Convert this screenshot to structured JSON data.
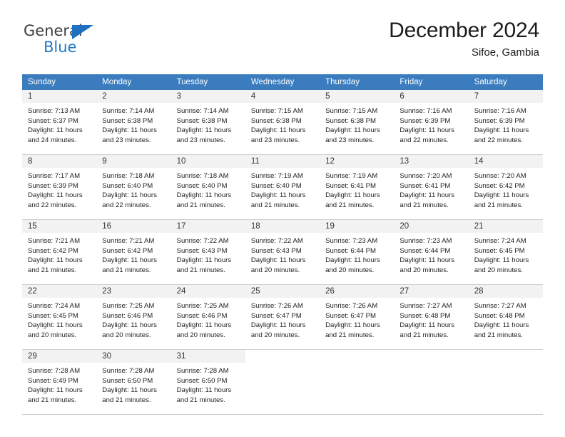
{
  "brand": {
    "name_top": "General",
    "name_bottom": "Blue",
    "triangle_color": "#1f70c1",
    "text_color": "#3d3d3d",
    "blue_color": "#2079c8"
  },
  "header": {
    "title": "December 2024",
    "subtitle": "Sifoe, Gambia",
    "header_bg": "#3a7cbe",
    "daynum_bg": "#f2f2f2"
  },
  "weekday_headers": [
    "Sunday",
    "Monday",
    "Tuesday",
    "Wednesday",
    "Thursday",
    "Friday",
    "Saturday"
  ],
  "labels": {
    "sunrise_prefix": "Sunrise:",
    "sunset_prefix": "Sunset:",
    "daylight_prefix": "Daylight:"
  },
  "weeks": [
    [
      {
        "day": "1",
        "sunrise": "Sunrise: 7:13 AM",
        "sunset": "Sunset: 6:37 PM",
        "daylight_line1": "Daylight: 11 hours",
        "daylight_line2": "and 24 minutes."
      },
      {
        "day": "2",
        "sunrise": "Sunrise: 7:14 AM",
        "sunset": "Sunset: 6:38 PM",
        "daylight_line1": "Daylight: 11 hours",
        "daylight_line2": "and 23 minutes."
      },
      {
        "day": "3",
        "sunrise": "Sunrise: 7:14 AM",
        "sunset": "Sunset: 6:38 PM",
        "daylight_line1": "Daylight: 11 hours",
        "daylight_line2": "and 23 minutes."
      },
      {
        "day": "4",
        "sunrise": "Sunrise: 7:15 AM",
        "sunset": "Sunset: 6:38 PM",
        "daylight_line1": "Daylight: 11 hours",
        "daylight_line2": "and 23 minutes."
      },
      {
        "day": "5",
        "sunrise": "Sunrise: 7:15 AM",
        "sunset": "Sunset: 6:38 PM",
        "daylight_line1": "Daylight: 11 hours",
        "daylight_line2": "and 23 minutes."
      },
      {
        "day": "6",
        "sunrise": "Sunrise: 7:16 AM",
        "sunset": "Sunset: 6:39 PM",
        "daylight_line1": "Daylight: 11 hours",
        "daylight_line2": "and 22 minutes."
      },
      {
        "day": "7",
        "sunrise": "Sunrise: 7:16 AM",
        "sunset": "Sunset: 6:39 PM",
        "daylight_line1": "Daylight: 11 hours",
        "daylight_line2": "and 22 minutes."
      }
    ],
    [
      {
        "day": "8",
        "sunrise": "Sunrise: 7:17 AM",
        "sunset": "Sunset: 6:39 PM",
        "daylight_line1": "Daylight: 11 hours",
        "daylight_line2": "and 22 minutes."
      },
      {
        "day": "9",
        "sunrise": "Sunrise: 7:18 AM",
        "sunset": "Sunset: 6:40 PM",
        "daylight_line1": "Daylight: 11 hours",
        "daylight_line2": "and 22 minutes."
      },
      {
        "day": "10",
        "sunrise": "Sunrise: 7:18 AM",
        "sunset": "Sunset: 6:40 PM",
        "daylight_line1": "Daylight: 11 hours",
        "daylight_line2": "and 21 minutes."
      },
      {
        "day": "11",
        "sunrise": "Sunrise: 7:19 AM",
        "sunset": "Sunset: 6:40 PM",
        "daylight_line1": "Daylight: 11 hours",
        "daylight_line2": "and 21 minutes."
      },
      {
        "day": "12",
        "sunrise": "Sunrise: 7:19 AM",
        "sunset": "Sunset: 6:41 PM",
        "daylight_line1": "Daylight: 11 hours",
        "daylight_line2": "and 21 minutes."
      },
      {
        "day": "13",
        "sunrise": "Sunrise: 7:20 AM",
        "sunset": "Sunset: 6:41 PM",
        "daylight_line1": "Daylight: 11 hours",
        "daylight_line2": "and 21 minutes."
      },
      {
        "day": "14",
        "sunrise": "Sunrise: 7:20 AM",
        "sunset": "Sunset: 6:42 PM",
        "daylight_line1": "Daylight: 11 hours",
        "daylight_line2": "and 21 minutes."
      }
    ],
    [
      {
        "day": "15",
        "sunrise": "Sunrise: 7:21 AM",
        "sunset": "Sunset: 6:42 PM",
        "daylight_line1": "Daylight: 11 hours",
        "daylight_line2": "and 21 minutes."
      },
      {
        "day": "16",
        "sunrise": "Sunrise: 7:21 AM",
        "sunset": "Sunset: 6:42 PM",
        "daylight_line1": "Daylight: 11 hours",
        "daylight_line2": "and 21 minutes."
      },
      {
        "day": "17",
        "sunrise": "Sunrise: 7:22 AM",
        "sunset": "Sunset: 6:43 PM",
        "daylight_line1": "Daylight: 11 hours",
        "daylight_line2": "and 21 minutes."
      },
      {
        "day": "18",
        "sunrise": "Sunrise: 7:22 AM",
        "sunset": "Sunset: 6:43 PM",
        "daylight_line1": "Daylight: 11 hours",
        "daylight_line2": "and 20 minutes."
      },
      {
        "day": "19",
        "sunrise": "Sunrise: 7:23 AM",
        "sunset": "Sunset: 6:44 PM",
        "daylight_line1": "Daylight: 11 hours",
        "daylight_line2": "and 20 minutes."
      },
      {
        "day": "20",
        "sunrise": "Sunrise: 7:23 AM",
        "sunset": "Sunset: 6:44 PM",
        "daylight_line1": "Daylight: 11 hours",
        "daylight_line2": "and 20 minutes."
      },
      {
        "day": "21",
        "sunrise": "Sunrise: 7:24 AM",
        "sunset": "Sunset: 6:45 PM",
        "daylight_line1": "Daylight: 11 hours",
        "daylight_line2": "and 20 minutes."
      }
    ],
    [
      {
        "day": "22",
        "sunrise": "Sunrise: 7:24 AM",
        "sunset": "Sunset: 6:45 PM",
        "daylight_line1": "Daylight: 11 hours",
        "daylight_line2": "and 20 minutes."
      },
      {
        "day": "23",
        "sunrise": "Sunrise: 7:25 AM",
        "sunset": "Sunset: 6:46 PM",
        "daylight_line1": "Daylight: 11 hours",
        "daylight_line2": "and 20 minutes."
      },
      {
        "day": "24",
        "sunrise": "Sunrise: 7:25 AM",
        "sunset": "Sunset: 6:46 PM",
        "daylight_line1": "Daylight: 11 hours",
        "daylight_line2": "and 20 minutes."
      },
      {
        "day": "25",
        "sunrise": "Sunrise: 7:26 AM",
        "sunset": "Sunset: 6:47 PM",
        "daylight_line1": "Daylight: 11 hours",
        "daylight_line2": "and 20 minutes."
      },
      {
        "day": "26",
        "sunrise": "Sunrise: 7:26 AM",
        "sunset": "Sunset: 6:47 PM",
        "daylight_line1": "Daylight: 11 hours",
        "daylight_line2": "and 21 minutes."
      },
      {
        "day": "27",
        "sunrise": "Sunrise: 7:27 AM",
        "sunset": "Sunset: 6:48 PM",
        "daylight_line1": "Daylight: 11 hours",
        "daylight_line2": "and 21 minutes."
      },
      {
        "day": "28",
        "sunrise": "Sunrise: 7:27 AM",
        "sunset": "Sunset: 6:48 PM",
        "daylight_line1": "Daylight: 11 hours",
        "daylight_line2": "and 21 minutes."
      }
    ],
    [
      {
        "day": "29",
        "sunrise": "Sunrise: 7:28 AM",
        "sunset": "Sunset: 6:49 PM",
        "daylight_line1": "Daylight: 11 hours",
        "daylight_line2": "and 21 minutes."
      },
      {
        "day": "30",
        "sunrise": "Sunrise: 7:28 AM",
        "sunset": "Sunset: 6:50 PM",
        "daylight_line1": "Daylight: 11 hours",
        "daylight_line2": "and 21 minutes."
      },
      {
        "day": "31",
        "sunrise": "Sunrise: 7:28 AM",
        "sunset": "Sunset: 6:50 PM",
        "daylight_line1": "Daylight: 11 hours",
        "daylight_line2": "and 21 minutes."
      },
      {
        "day": "",
        "sunrise": "",
        "sunset": "",
        "daylight_line1": "",
        "daylight_line2": ""
      },
      {
        "day": "",
        "sunrise": "",
        "sunset": "",
        "daylight_line1": "",
        "daylight_line2": ""
      },
      {
        "day": "",
        "sunrise": "",
        "sunset": "",
        "daylight_line1": "",
        "daylight_line2": ""
      },
      {
        "day": "",
        "sunrise": "",
        "sunset": "",
        "daylight_line1": "",
        "daylight_line2": ""
      }
    ]
  ]
}
